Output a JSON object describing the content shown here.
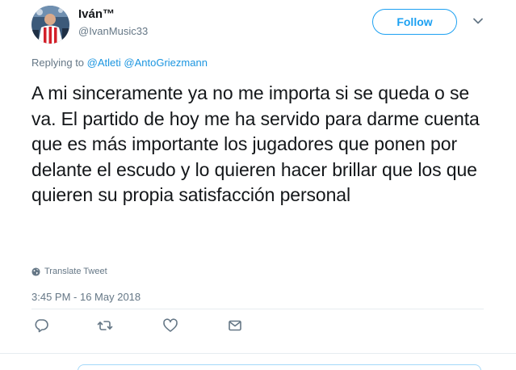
{
  "user": {
    "display_name": "Iván™",
    "handle": "@IvanMusic33"
  },
  "follow_label": "Follow",
  "reply_context": {
    "prefix": "Replying to",
    "mentions": [
      "@Atleti",
      "@AntoGriezmann"
    ]
  },
  "tweet_text": "A mi sinceramente ya no me importa si se queda o se va. El partido de hoy me ha servido para darme cuenta que es más importante los jugadores que ponen por delante el escudo y lo quieren hacer brillar que los que quieren su propia satisfacción personal",
  "translate_label": "Translate Tweet",
  "timestamp": "3:45 PM - 16 May 2018",
  "icons": {
    "reply": "reply-icon",
    "retweet": "retweet-icon",
    "like": "heart-icon",
    "dm": "envelope-icon",
    "more": "chevron-down-icon",
    "translate": "globe-icon"
  },
  "colors": {
    "accent": "#1da1f2",
    "link": "#1b95e0",
    "secondary_text": "#657786",
    "primary_text": "#14171a",
    "divider": "#e6ecf0"
  }
}
